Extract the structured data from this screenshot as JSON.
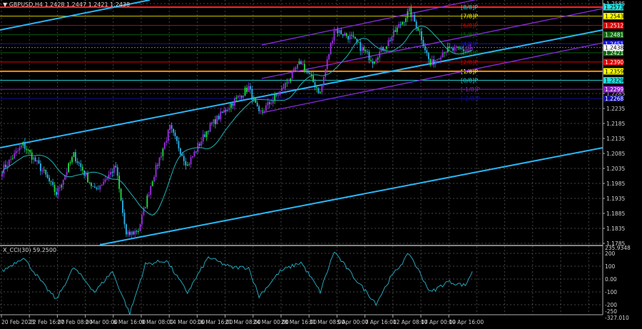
{
  "header": {
    "symbol_timeframe": "GBPUSD,H4",
    "ohlc": "1.2428 1.2447 1.2421 1.2438",
    "arrow": "▼"
  },
  "indicator": {
    "label": "X_CCI(30) 59.2500"
  },
  "colors": {
    "background": "#000000",
    "bull": "#9b30e8",
    "bear": "#2ab4ef",
    "ma": "#1fb5b5",
    "trend": "#29b6f6",
    "channel": "#8a2be2",
    "cci": "#27b3c9",
    "grid": "#5a5a5a"
  },
  "chart_data": {
    "type": "candlestick",
    "symbol": "GBPUSD",
    "timeframe": "H4",
    "ylim": [
      1.1775,
      1.2595
    ],
    "price_ticks": [
      "1.2585",
      "1.2285",
      "1.2235",
      "1.2185",
      "1.2135",
      "1.2085",
      "1.2035",
      "1.1985",
      "1.1935",
      "1.1885",
      "1.1835",
      "1.1785"
    ],
    "x_labels": [
      "20 Feb 2023",
      "22 Feb 16:00",
      "27 Feb 08:00",
      "2 Mar 00:00",
      "6 Mar 16:00",
      "9 Mar 08:00",
      "14 Mar 00:00",
      "16 Mar 16:00",
      "21 Mar 08:00",
      "24 Mar 00:00",
      "28 Mar 16:00",
      "31 Mar 08:00",
      "5 Apr 00:00",
      "7 Apr 16:00",
      "12 Apr 08:00",
      "17 Apr 00:00",
      "19 Apr 16:00"
    ],
    "bars_per_label": 16,
    "close_path": [
      [
        0,
        1.203
      ],
      [
        12,
        1.2115
      ],
      [
        24,
        1.202
      ],
      [
        31,
        1.195
      ],
      [
        41,
        1.208
      ],
      [
        53,
        1.196
      ],
      [
        65,
        1.204
      ],
      [
        71,
        1.181
      ],
      [
        78,
        1.183
      ],
      [
        86,
        1.2
      ],
      [
        96,
        1.217
      ],
      [
        106,
        1.2045
      ],
      [
        118,
        1.217
      ],
      [
        131,
        1.225
      ],
      [
        141,
        1.2305
      ],
      [
        147,
        1.2215
      ],
      [
        159,
        1.229
      ],
      [
        171,
        1.239
      ],
      [
        182,
        1.2285
      ],
      [
        190,
        1.25
      ],
      [
        200,
        1.247
      ],
      [
        212,
        1.2395
      ],
      [
        220,
        1.245
      ],
      [
        233,
        1.256
      ],
      [
        239,
        1.249
      ],
      [
        245,
        1.238
      ],
      [
        253,
        1.243
      ],
      [
        265,
        1.243
      ],
      [
        269,
        1.2438
      ]
    ],
    "cci_path": [
      [
        0,
        60
      ],
      [
        12,
        170
      ],
      [
        24,
        -50
      ],
      [
        31,
        -160
      ],
      [
        41,
        90
      ],
      [
        53,
        -100
      ],
      [
        63,
        60
      ],
      [
        73,
        -270
      ],
      [
        82,
        115
      ],
      [
        94,
        145
      ],
      [
        106,
        -105
      ],
      [
        118,
        170
      ],
      [
        131,
        90
      ],
      [
        141,
        90
      ],
      [
        147,
        -135
      ],
      [
        159,
        60
      ],
      [
        171,
        130
      ],
      [
        182,
        -100
      ],
      [
        190,
        215
      ],
      [
        200,
        35
      ],
      [
        214,
        -190
      ],
      [
        222,
        5
      ],
      [
        233,
        200
      ],
      [
        245,
        -105
      ],
      [
        255,
        -20
      ],
      [
        265,
        -50
      ],
      [
        269,
        59.25
      ]
    ],
    "cci_ticks": [
      "235.9348",
      "200",
      "100",
      "0.00",
      "-100",
      "-200",
      "-250",
      "-327.010"
    ],
    "murrey_levels": [
      {
        "label": "[8/8]P",
        "price": "1.2573",
        "color": "#ff2020",
        "box": "#22e0e0"
      },
      {
        "label": "[7/8]P",
        "price": "1.2543",
        "color": "#d4c800",
        "box": "#ffff00"
      },
      {
        "label": "[6/8]P",
        "price": "1.2512",
        "color": "#cc0000",
        "box": "#e00000"
      },
      {
        "label": "[5/8]P",
        "price": "1.2481",
        "color": "#0a5a0a",
        "box": "#0a6a0a"
      },
      {
        "label": "[4/8]P",
        "price": "1.2451",
        "color": "#1a1aa0",
        "box": "#1010ff"
      },
      {
        "label": "[3/8]P",
        "price": "1.2421",
        "color": "#0a5a0a",
        "box": "#0a6a0a"
      },
      {
        "label": "[2/8]P",
        "price": "1.2390",
        "color": "#dd0000",
        "box": "#e00000"
      },
      {
        "label": "[1/8]P",
        "price": "1.2359",
        "color": "#ff8c00",
        "box": "#ffff00"
      },
      {
        "label": "[0/8]P",
        "price": "1.2329",
        "color": "#20c8c8",
        "box": "#22e0e0"
      },
      {
        "label": "[-1/8]P",
        "price": "1.2299",
        "color": "#8a1fc8",
        "box": "#8a1fc8"
      },
      {
        "label": "[-2/8]P",
        "price": "1.2268",
        "color": "#101090",
        "box": "#1010a0"
      }
    ],
    "current_price": "1.2438"
  }
}
